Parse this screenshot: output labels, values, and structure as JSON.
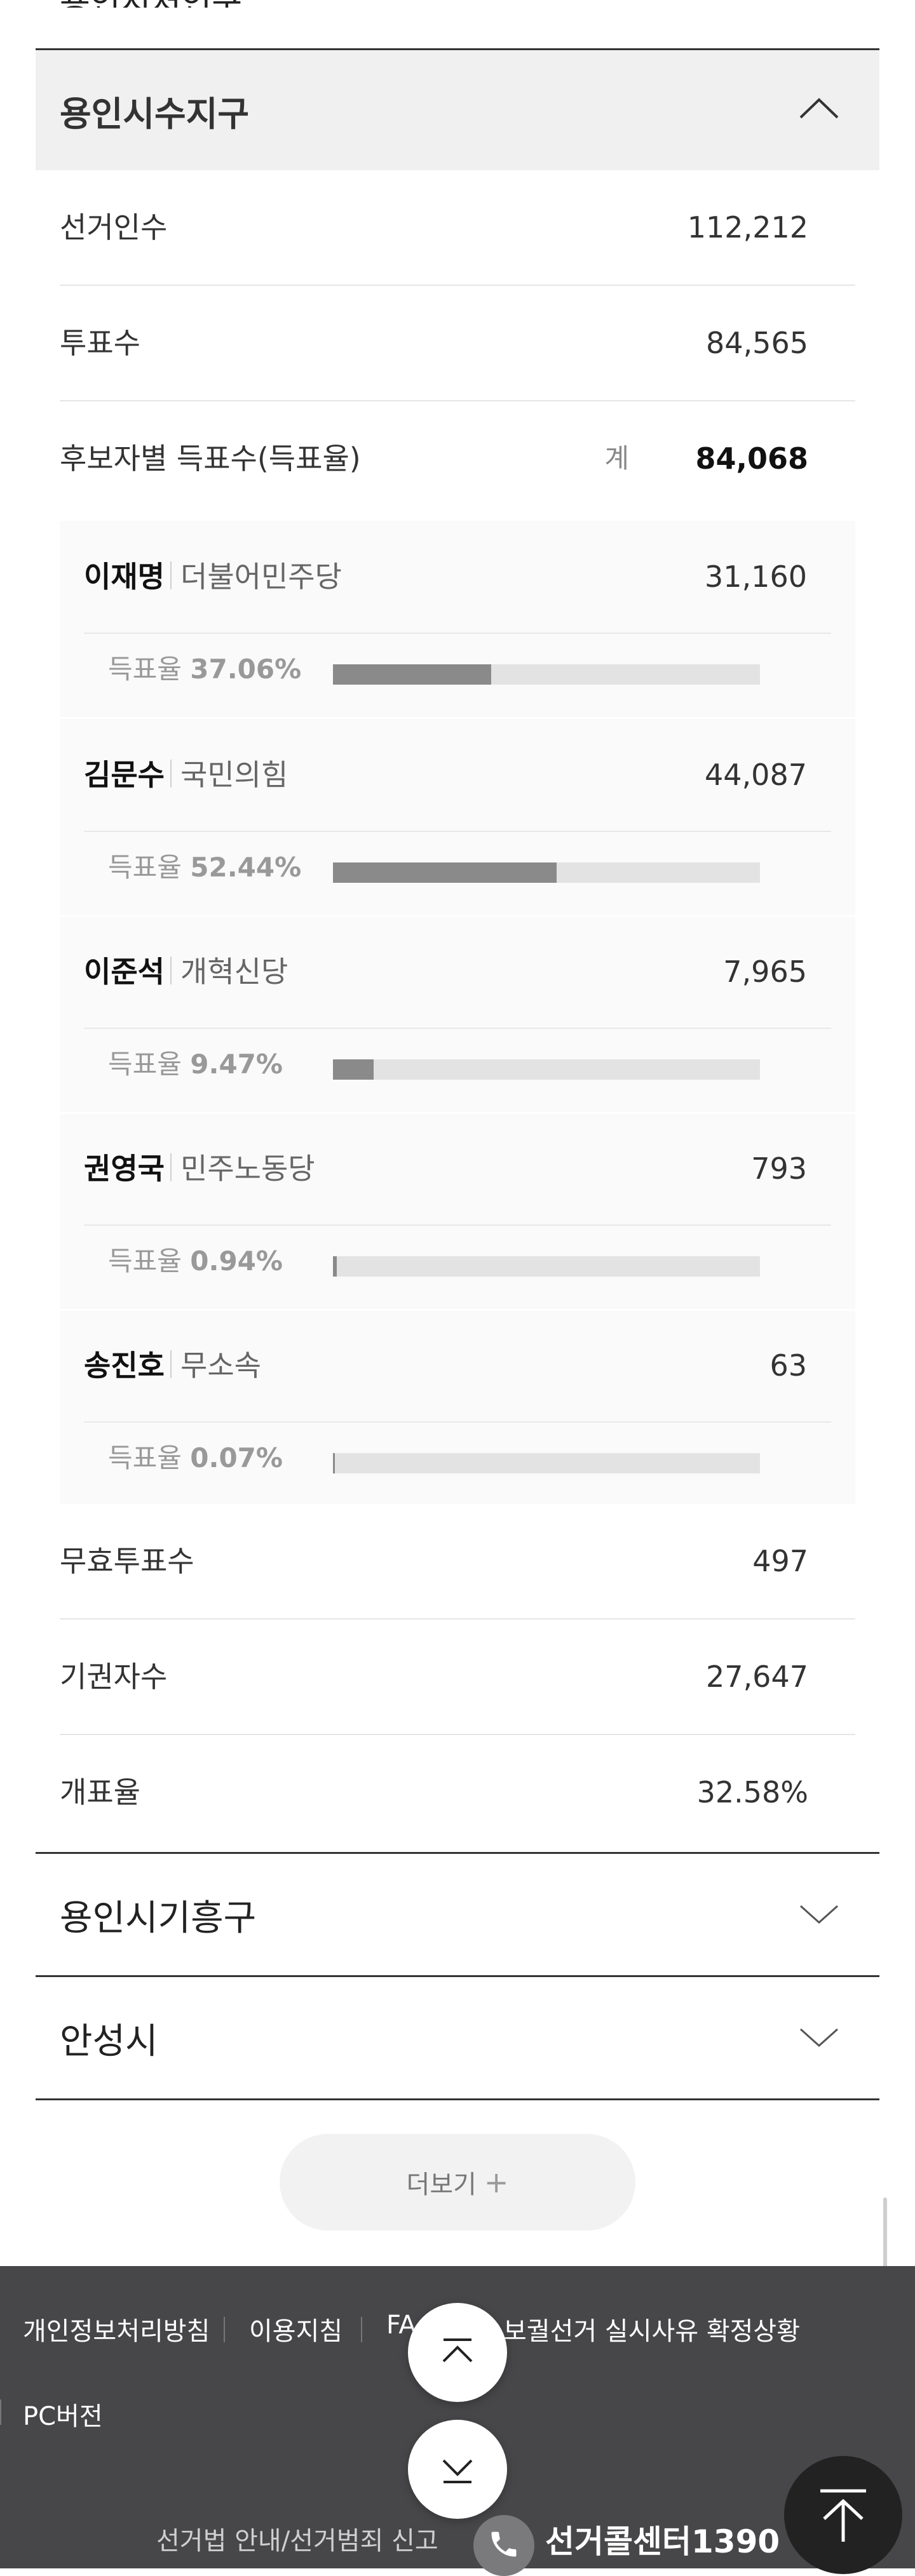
{
  "prev_district_title_cut": "용인시처인구",
  "district": {
    "title": "용인시수지구",
    "electorate_label": "선거인수",
    "electorate_value": "112,212",
    "turnout_label": "투표수",
    "turnout_value": "84,565",
    "votes_label": "후보자별 득표수(득표율)",
    "sum_label": "계",
    "sum_value": "84,068",
    "rate_prefix": "득표율",
    "candidates": [
      {
        "name": "이재명",
        "party": "더불어민주당",
        "votes": "31,160",
        "rate": "37.06%",
        "rate_value": 37.06
      },
      {
        "name": "김문수",
        "party": "국민의힘",
        "votes": "44,087",
        "rate": "52.44%",
        "rate_value": 52.44
      },
      {
        "name": "이준석",
        "party": "개혁신당",
        "votes": "7,965",
        "rate": "9.47%",
        "rate_value": 9.47
      },
      {
        "name": "권영국",
        "party": "민주노동당",
        "votes": "793",
        "rate": "0.94%",
        "rate_value": 0.94
      },
      {
        "name": "송진호",
        "party": "무소속",
        "votes": "63",
        "rate": "0.07%",
        "rate_value": 0.07
      }
    ],
    "invalid_label": "무효투표수",
    "invalid_value": "497",
    "abstain_label": "기권자수",
    "abstain_value": "27,647",
    "counted_label": "개표율",
    "counted_value": "32.58%"
  },
  "other_districts": [
    {
      "title": "용인시기흥구"
    },
    {
      "title": "안성시"
    }
  ],
  "more_button": {
    "label": "더보기",
    "plus": "+"
  },
  "footer": {
    "links": [
      "개인정보처리방침",
      "이용지침",
      "FA",
      "보궐선거 실시사유 확정상황"
    ],
    "pc_version": "PC버전",
    "election_law": "선거법 안내/선거범죄 신고",
    "callcenter": "선거콜센터1390"
  },
  "icons": {
    "collapse": "chevron-up-icon",
    "expand": "chevron-down-icon",
    "scroll_top": "arrow-up-to-top-icon",
    "phone": "phone-icon"
  },
  "colors": {
    "bar_fill": "#8a8a8a",
    "bar_track": "#e3e3e3",
    "footer_bg": "#47474a"
  }
}
